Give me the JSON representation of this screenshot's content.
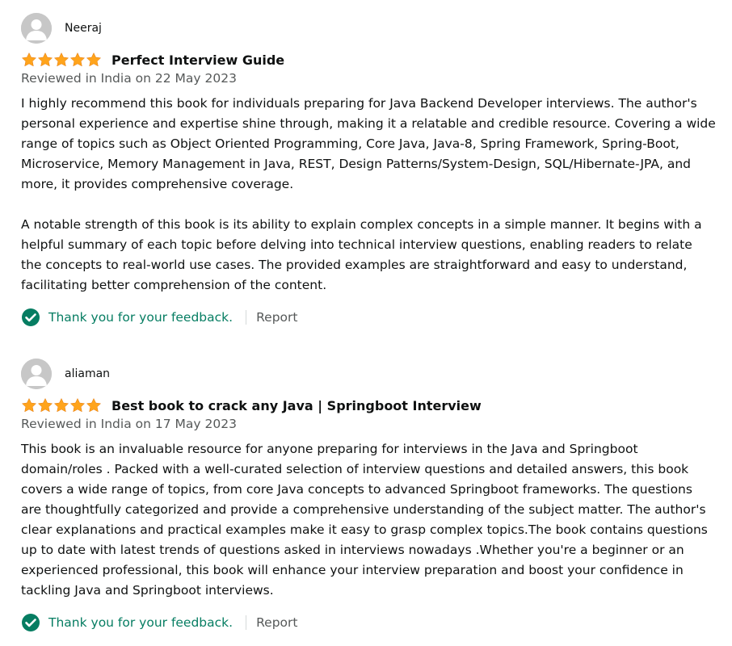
{
  "colors": {
    "star": "#ffa41c",
    "check": "#067d62",
    "feedback_text": "#067d62",
    "date_text": "#565959",
    "body_text": "#0f1111",
    "avatar_bg": "#c7c7c7"
  },
  "icons": {
    "avatar": "person-silhouette",
    "star": "filled-star",
    "check": "check-circle"
  },
  "reviews": [
    {
      "reviewer": "Neeraj",
      "stars": 5,
      "title": "Perfect Interview Guide",
      "date": "Reviewed in India on 22 May 2023",
      "paragraphs": [
        "I highly recommend this book for individuals preparing for Java Backend Developer interviews. The author's personal experience and expertise shine through, making it a relatable and credible resource. Covering a wide range of topics such as Object Oriented Programming, Core Java, Java-8, Spring Framework, Spring-Boot, Microservice, Memory Management in Java, REST, Design Patterns/System-Design, SQL/Hibernate-JPA, and more, it provides comprehensive coverage.",
        "A notable strength of this book is its ability to explain complex concepts in a simple manner. It begins with a helpful summary of each topic before delving into technical interview questions, enabling readers to relate the concepts to real-world use cases. The provided examples are straightforward and easy to understand, facilitating better comprehension of the content."
      ],
      "feedback": "Thank you for your feedback.",
      "report": "Report"
    },
    {
      "reviewer": "aliaman",
      "stars": 5,
      "title": "Best book to crack any Java | Springboot Interview",
      "date": "Reviewed in India on 17 May 2023",
      "paragraphs": [
        "This book is an invaluable resource for anyone preparing for interviews in the Java and Springboot domain/roles . Packed with a well-curated selection of interview questions and detailed answers, this book covers a wide range of topics, from core Java concepts to advanced Springboot frameworks. The questions are thoughtfully categorized and provide a comprehensive understanding of the subject matter. The author's clear explanations and practical examples make it easy to grasp complex topics.The book contains questions up to date with latest trends of questions asked in interviews nowadays .Whether you're a beginner or an experienced professional, this book will enhance your interview preparation and boost your confidence in tackling Java and Springboot interviews."
      ],
      "feedback": "Thank you for your feedback.",
      "report": "Report"
    }
  ]
}
